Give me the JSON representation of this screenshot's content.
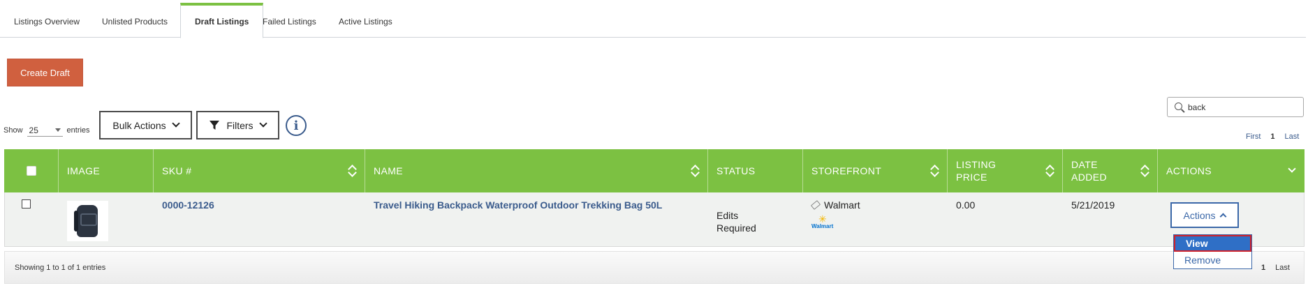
{
  "tabs": [
    {
      "label": "Listings Overview"
    },
    {
      "label": "Unlisted Products"
    },
    {
      "label": "Draft Listings"
    },
    {
      "label": "Failed Listings"
    },
    {
      "label": "Active Listings"
    }
  ],
  "toolbar": {
    "create_label": "Create Draft",
    "show_label": "Show",
    "show_value": "25",
    "entries_label": "entries",
    "bulk_label": "Bulk Actions",
    "filters_label": "Filters",
    "info_glyph": "i"
  },
  "search": {
    "value": "back"
  },
  "pager_top": {
    "first": "First",
    "page": "1",
    "last": "Last"
  },
  "columns": {
    "image": "IMAGE",
    "sku": "SKU #",
    "name": "NAME",
    "status": "STATUS",
    "storefront": "STOREFRONT",
    "price_line1": "LISTING",
    "price_line2": "PRICE",
    "date_line1": "DATE",
    "date_line2": "ADDED",
    "actions": "ACTIONS"
  },
  "rows": [
    {
      "sku": "0000-12126",
      "name": "Travel Hiking Backpack Waterproof Outdoor Trekking Bag 50L",
      "status_line1": "Edits",
      "status_line2": "Required",
      "storefront": "Walmart",
      "storefront_logo": "Walmart",
      "price": "0.00",
      "date": "5/21/2019",
      "actions_label": "Actions"
    }
  ],
  "actions_menu": {
    "view": "View",
    "remove": "Remove"
  },
  "footer": {
    "summary": "Showing 1 to 1 of 1 entries",
    "page": "1",
    "last": "Last"
  },
  "colors": {
    "accent_green": "#7cc142",
    "create_button": "#d0603f",
    "link_blue": "#3a5b8c"
  }
}
